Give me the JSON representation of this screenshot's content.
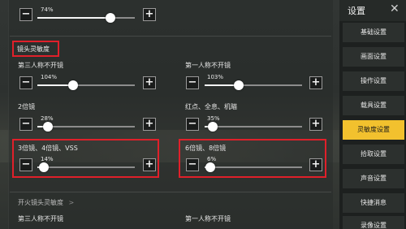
{
  "top_slider": {
    "value_label": "74%",
    "value": 0.74
  },
  "section1": {
    "title": "镜头灵敏度",
    "sliders": [
      {
        "label": "第三人称不开镜",
        "value_label": "104%",
        "value": 0.52
      },
      {
        "label": "第一人称不开镜",
        "value_label": "103%",
        "value": 0.51
      },
      {
        "label": "2倍镜",
        "value_label": "28%",
        "value": 0.14
      },
      {
        "label": "红点、全息、机瞄",
        "value_label": "35%",
        "value": 0.18
      },
      {
        "label": "3倍镜、4倍镜、VSS",
        "value_label": "14%",
        "value": 0.07
      },
      {
        "label": "6倍镜、8倍镜",
        "value_label": "6%",
        "value": 0.03
      }
    ]
  },
  "section2": {
    "title": "开火镜头灵敏度",
    "title_suffix": ">",
    "labels": [
      "第三人称不开镜",
      "第一人称不开镜"
    ]
  },
  "buttons": {
    "minus": "−",
    "plus": "+"
  },
  "sidebar": {
    "title": "设置",
    "close": "✕",
    "items": [
      {
        "label": "基础设置",
        "active": false
      },
      {
        "label": "画面设置",
        "active": false
      },
      {
        "label": "操作设置",
        "active": false
      },
      {
        "label": "载具设置",
        "active": false
      },
      {
        "label": "灵敏度设置",
        "active": true
      },
      {
        "label": "拾取设置",
        "active": false
      },
      {
        "label": "声音设置",
        "active": false
      },
      {
        "label": "快捷消息",
        "active": false
      },
      {
        "label": "录像设置",
        "active": false
      }
    ]
  },
  "colors": {
    "accent": "#f2c12e",
    "highlight_box": "#e0202a"
  }
}
